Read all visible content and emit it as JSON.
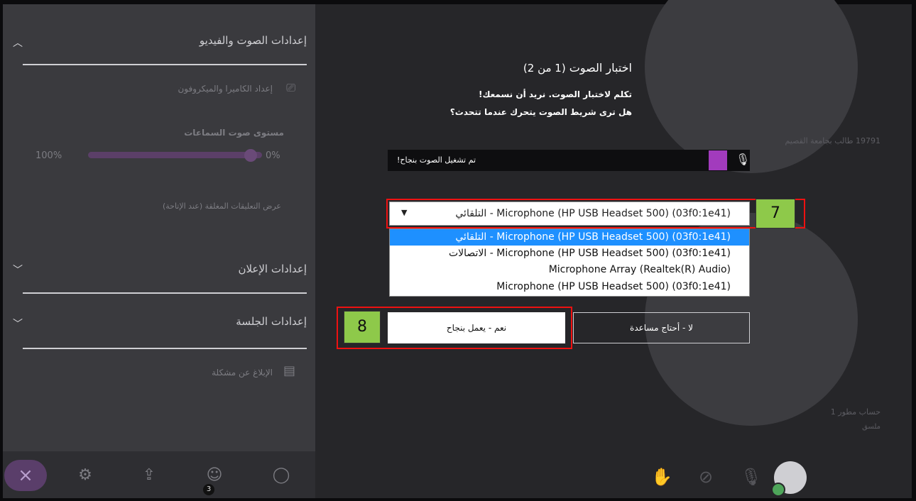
{
  "settings_panel": {
    "audio_video_title": "إعدادات الصوت والفيديو",
    "camera_mic_setup": "إعداد الكاميرا والميكروفون",
    "speaker_volume_label": "مستوى صوت السماعات",
    "speaker_volume_max": "100%",
    "speaker_volume_min": "0%",
    "speaker_volume_level": 1.0,
    "captions_text": "عرض التعليقات المغلقة (عند الإتاحة)",
    "notifications_title": "إعدادات الإعلان",
    "session_title": "إعدادات الجلسة",
    "report_problem": "الإبلاغ عن مشكلة"
  },
  "bottom_bar": {
    "close_icon": "close-icon",
    "attendees_count": "3",
    "icons": [
      "gear-icon",
      "share-icon",
      "attendees-icon",
      "chat-icon"
    ]
  },
  "participants": {
    "top_tile_name": "19791 طالب بجامعة القصيم",
    "bottom_tile_name": "حساب مطور 1",
    "bottom_tile_status": "ملسق"
  },
  "dialog": {
    "title": "اختبار الصوت",
    "step_count": "(1 من 2)",
    "instruction_1": "تكلم لاختبار الصوت. نريد أن نسمعك!",
    "instruction_2": "هل ترى شريط الصوت يتحرك عندما تتحدث؟",
    "meter_status": "تم تشغيل الصوت بنجاح!",
    "meter_level": 0.06,
    "device_select": {
      "selected": "التلقائي - Microphone (HP USB Headset 500) (03f0:1e41)",
      "options": [
        "التلقائي - Microphone (HP USB Headset 500) (03f0:1e41)",
        "الاتصالات - Microphone (HP USB Headset 500) (03f0:1e41)",
        "Microphone Array (Realtek(R) Audio)",
        "Microphone (HP USB Headset 500) (03f0:1e41)"
      ]
    },
    "no_button": "لا - أحتاج مساعدة",
    "yes_button": "نعم - يعمل بنجاح"
  },
  "annotations": {
    "step_7": "7",
    "step_8": "8",
    "highlight_color": "#ee1111",
    "step_color": "#8ec94a"
  },
  "colors": {
    "accent_purple": "#a23bbd",
    "select_highlight": "#1e90ff"
  }
}
